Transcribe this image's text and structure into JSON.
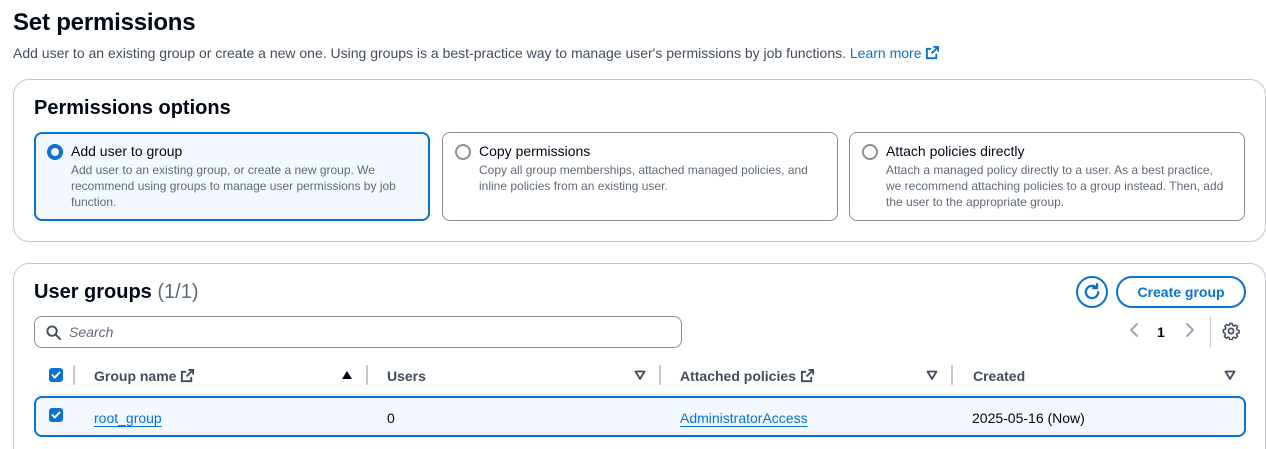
{
  "header": {
    "title": "Set permissions",
    "description": "Add user to an existing group or create a new one. Using groups is a best-practice way to manage user's permissions by job functions.",
    "learn_more": "Learn more"
  },
  "permissions_options": {
    "heading": "Permissions options",
    "tiles": [
      {
        "title": "Add user to group",
        "description": "Add user to an existing group, or create a new group. We recommend using groups to manage user permissions by job function.",
        "selected": true
      },
      {
        "title": "Copy permissions",
        "description": "Copy all group memberships, attached managed policies, and inline policies from an existing user.",
        "selected": false
      },
      {
        "title": "Attach policies directly",
        "description": "Attach a managed policy directly to a user. As a best practice, we recommend attaching policies to a group instead. Then, add the user to the appropriate group.",
        "selected": false
      }
    ]
  },
  "user_groups": {
    "heading": "User groups",
    "count": "(1/1)",
    "create_label": "Create group",
    "search_placeholder": "Search",
    "page_number": "1",
    "columns": [
      "Group name",
      "Users",
      "Attached policies",
      "Created"
    ],
    "rows": [
      {
        "group_name": "root_group",
        "users": "0",
        "attached_policies": "AdministratorAccess",
        "created": "2025-05-16 (Now)",
        "selected": true
      }
    ]
  },
  "icons": {
    "external": "external-link-icon",
    "refresh": "refresh-icon",
    "search": "search-icon",
    "settings": "gear-icon",
    "sort_asc": "sort-ascending-icon",
    "sort_desc": "sort-descending-icon"
  },
  "colors": {
    "accent": "#0972d3",
    "selected_bg": "#f2f8fd",
    "border": "#c6c6cd",
    "text": "#000716",
    "secondary_text": "#5f6b7a"
  }
}
